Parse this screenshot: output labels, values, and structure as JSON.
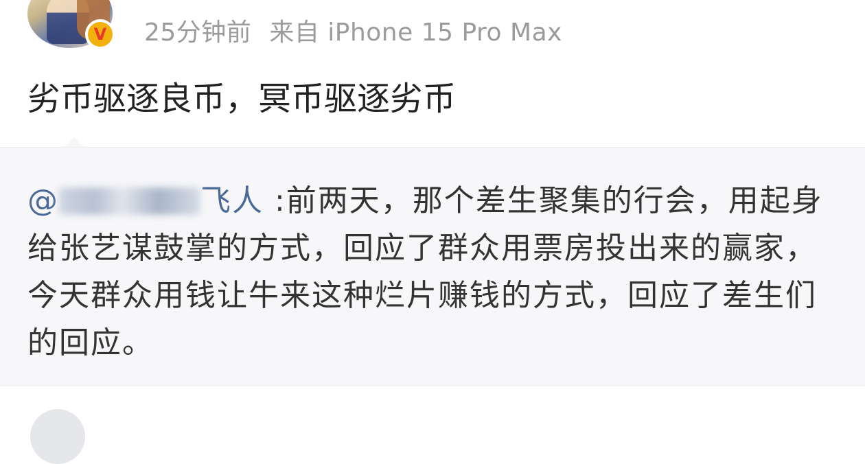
{
  "post": {
    "time_ago": "25分钟前",
    "source": "来自 iPhone 15 Pro Max",
    "text": "劣币驱逐良币，冥币驱逐劣币"
  },
  "quote": {
    "at_sign": "@",
    "mention_visible": "飞人",
    "body": " :前两天，那个差生聚集的行会，用起身给张艺谋鼓掌的方式，回应了群众用票房投出来的赢家，今天群众用钱让牛来这种烂片赚钱的方式，回应了差生们的回应。"
  },
  "icons": {
    "verified": "verified-v-badge-icon"
  },
  "colors": {
    "mention": "#4d6a97",
    "badge": "#f2b10c",
    "badge_letter": "#e8392b"
  }
}
